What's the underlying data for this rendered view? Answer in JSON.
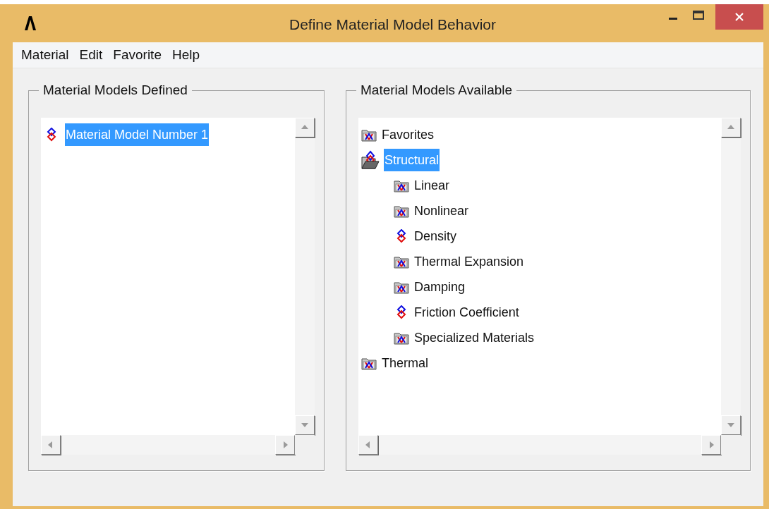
{
  "window": {
    "title": "Define Material Model Behavior"
  },
  "menu": [
    "Material",
    "Edit",
    "Favorite",
    "Help"
  ],
  "defined_panel": {
    "title": "Material Models Defined",
    "items": [
      {
        "label": "Material Model Number 1",
        "selected": true
      }
    ]
  },
  "available_panel": {
    "title": "Material Models Available",
    "tree": [
      {
        "label": "Favorites",
        "kind": "folder",
        "expanded": false,
        "selected": false
      },
      {
        "label": "Structural",
        "kind": "folder",
        "expanded": true,
        "selected": true,
        "children": [
          {
            "label": "Linear",
            "kind": "folder",
            "expanded": false,
            "selected": false
          },
          {
            "label": "Nonlinear",
            "kind": "folder",
            "expanded": false,
            "selected": false
          },
          {
            "label": "Density",
            "kind": "model",
            "selected": false
          },
          {
            "label": "Thermal Expansion",
            "kind": "folder",
            "expanded": false,
            "selected": false
          },
          {
            "label": "Damping",
            "kind": "folder",
            "expanded": false,
            "selected": false
          },
          {
            "label": "Friction Coefficient",
            "kind": "model",
            "selected": false
          },
          {
            "label": "Specialized Materials",
            "kind": "folder",
            "expanded": false,
            "selected": false
          }
        ]
      },
      {
        "label": "Thermal",
        "kind": "folder",
        "expanded": false,
        "selected": false
      }
    ]
  }
}
